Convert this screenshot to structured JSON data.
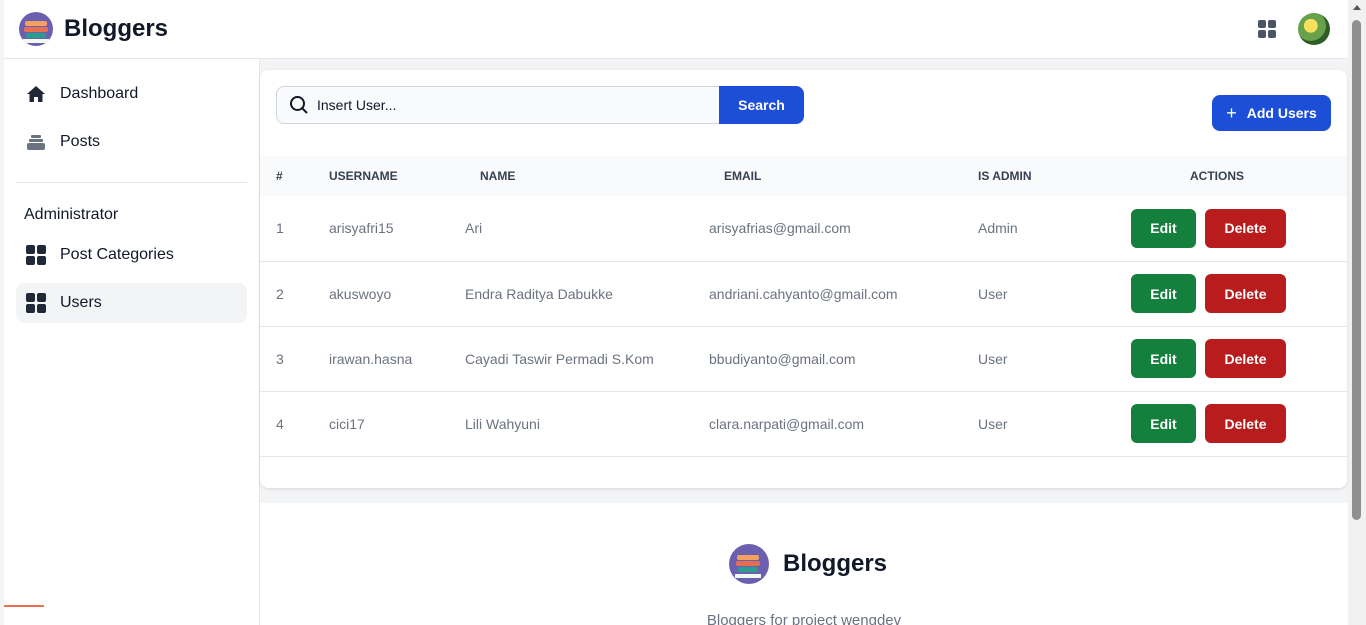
{
  "app": {
    "brand": "Bloggers"
  },
  "sidebar": {
    "items": [
      {
        "label": "Dashboard"
      },
      {
        "label": "Posts"
      }
    ],
    "section_label": "Administrator",
    "admin_items": [
      {
        "label": "Post Categories"
      },
      {
        "label": "Users"
      }
    ]
  },
  "search": {
    "placeholder": "Insert User...",
    "button": "Search"
  },
  "add_button": "Add Users",
  "table": {
    "headers": [
      "#",
      "USERNAME",
      "NAME",
      "EMAIL",
      "IS ADMIN",
      "ACTIONS"
    ],
    "rows": [
      {
        "num": "1",
        "username": "arisyafri15",
        "name": "Ari",
        "email": "arisyafrias@gmail.com",
        "role": "Admin",
        "edit": "Edit",
        "delete": "Delete"
      },
      {
        "num": "2",
        "username": "akuswoyo",
        "name": "Endra Raditya Dabukke",
        "email": "andriani.cahyanto@gmail.com",
        "role": "User",
        "edit": "Edit",
        "delete": "Delete"
      },
      {
        "num": "3",
        "username": "irawan.hasna",
        "name": "Cayadi Taswir Permadi S.Kom",
        "email": "bbudiyanto@gmail.com",
        "role": "User",
        "edit": "Edit",
        "delete": "Delete"
      },
      {
        "num": "4",
        "username": "cici17",
        "name": "Lili Wahyuni",
        "email": "clara.narpati@gmail.com",
        "role": "User",
        "edit": "Edit",
        "delete": "Delete"
      }
    ]
  },
  "footer": {
    "brand": "Bloggers",
    "description": "Bloggers for project wengdev"
  },
  "colors": {
    "primary": "#1d4ed8",
    "edit": "#15803d",
    "delete": "#b91c1c"
  },
  "icons": [
    "apps-icon",
    "avatar",
    "home-icon",
    "posts-icon",
    "grid-icon",
    "search-icon",
    "plus-icon"
  ]
}
